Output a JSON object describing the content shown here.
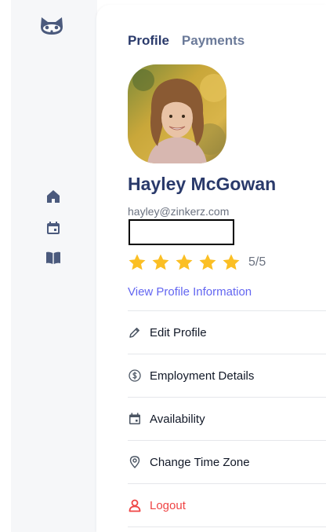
{
  "sidebar": {
    "logo_icon": "raccoon-logo-icon",
    "items": [
      {
        "icon": "home-icon"
      },
      {
        "icon": "calendar-icon"
      },
      {
        "icon": "book-icon"
      }
    ]
  },
  "tabs": [
    {
      "label": "Profile",
      "active": true
    },
    {
      "label": "Payments",
      "active": false
    }
  ],
  "profile": {
    "name": "Hayley McGowan",
    "email": "hayley@zinkerz.com",
    "rating_value": 5,
    "rating_max": 5,
    "rating_text": "5/5",
    "view_link": "View Profile Information"
  },
  "menu": [
    {
      "label": "Edit Profile",
      "icon": "pencil-icon"
    },
    {
      "label": "Employment Details",
      "icon": "dollar-circle-icon"
    },
    {
      "label": "Availability",
      "icon": "calendar-icon"
    },
    {
      "label": "Change Time Zone",
      "icon": "location-pin-icon"
    },
    {
      "label": "Logout",
      "icon": "user-icon"
    }
  ],
  "colors": {
    "primary": "#2a3a6b",
    "link": "#6366f1",
    "star": "#fbbf24",
    "danger": "#ef4444"
  }
}
